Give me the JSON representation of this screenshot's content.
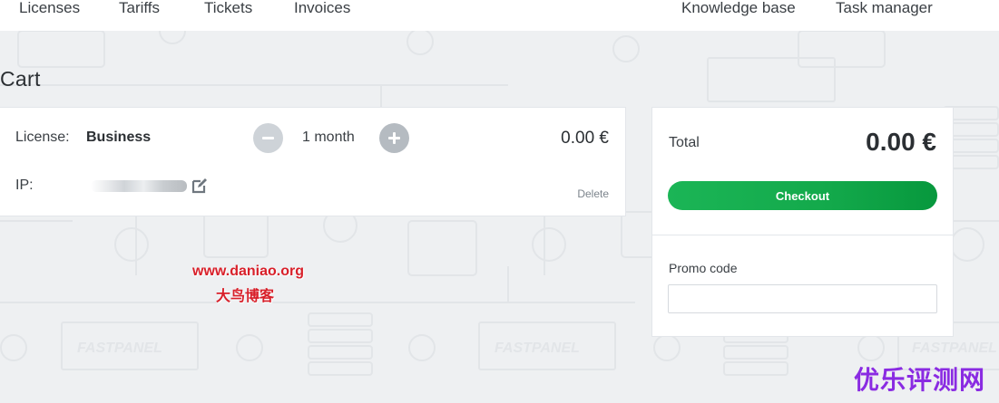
{
  "nav": {
    "left": [
      "Licenses",
      "Tariffs",
      "Tickets",
      "Invoices"
    ],
    "right": [
      "Knowledge base",
      "Task manager"
    ]
  },
  "page": {
    "title": "Cart"
  },
  "cart_item": {
    "license_label": "License:",
    "license_value": "Business",
    "duration": "1 month",
    "price": "0.00 €",
    "ip_label": "IP:",
    "delete_label": "Delete"
  },
  "summary": {
    "total_label": "Total",
    "total_value": "0.00 €",
    "checkout_label": "Checkout",
    "promo_label": "Promo code",
    "promo_value": ""
  },
  "background": {
    "brand": "FASTPANEL"
  },
  "watermarks": {
    "site": "www.daniao.org",
    "site_cn": "大鸟博客",
    "corner": "优乐评测网"
  },
  "colors": {
    "accent_green": "#13a94b",
    "stepper_gray": "#b5bbc1",
    "watermark_red": "#d8202a",
    "watermark_purple": "#8a2be2"
  }
}
